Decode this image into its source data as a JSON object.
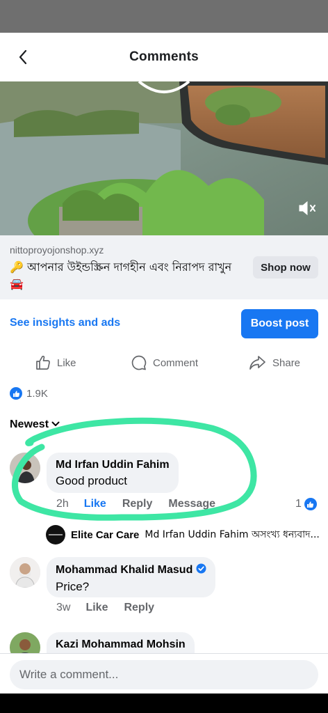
{
  "header": {
    "title": "Comments",
    "back_icon": "chevron-left-icon"
  },
  "video": {
    "mute_icon": "speaker-muted-icon"
  },
  "ad": {
    "domain": "nittoproyojonshop.xyz",
    "text": "🔑 আপনার উইন্ডস্ক্রিন দাগহীন এবং নিরাপদ রাখুন 🚘",
    "cta": "Shop now"
  },
  "post_actions": {
    "insights": "See insights and ads",
    "boost": "Boost post",
    "like": "Like",
    "comment": "Comment",
    "share": "Share"
  },
  "reactions": {
    "count": "1.9K",
    "icon": "like-icon"
  },
  "sort": {
    "label": "Newest",
    "icon": "chevron-down-icon"
  },
  "comments": [
    {
      "author": "Md Irfan Uddin Fahim",
      "text": "Good product",
      "time": "2h",
      "like": "Like",
      "reply": "Reply",
      "message": "Message",
      "like_count": "1"
    },
    {
      "author": "Mohammad Khalid Masud",
      "verified": true,
      "text": "Price?",
      "time": "3w",
      "like": "Like",
      "reply": "Reply"
    },
    {
      "author": "Kazi Mohammad Mohsin"
    }
  ],
  "reply_preview": {
    "author": "Elite Car Care",
    "text": "Md Irfan Uddin Fahim অসংখ্য ধন্যবাদ..."
  },
  "composer": {
    "placeholder": "Write a comment..."
  },
  "colors": {
    "accent": "#1877f2",
    "highlight": "#3ee6a4",
    "bubble": "#f0f2f5"
  }
}
